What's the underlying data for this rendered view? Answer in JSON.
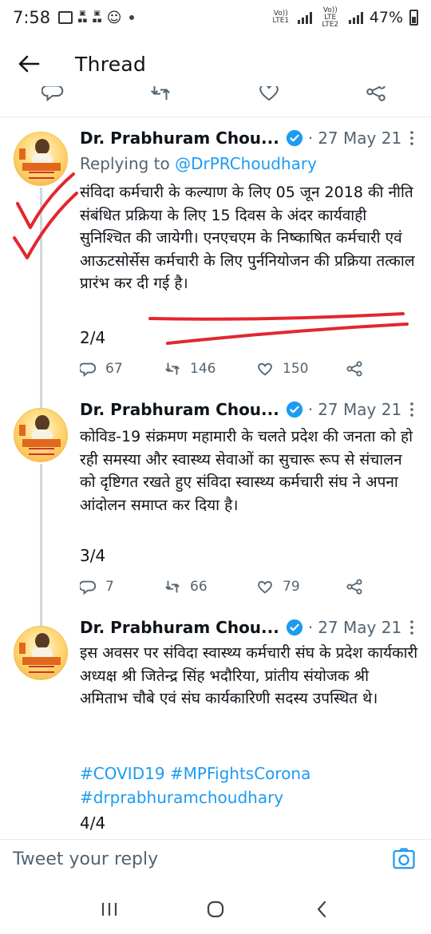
{
  "status_bar": {
    "time": "7:58",
    "net1": "Vo)) LTE1",
    "net2": "Vo)) LTE LTE2",
    "battery": "47%"
  },
  "header": {
    "title": "Thread"
  },
  "tweets": [
    {
      "name": "Dr. Prabhuram Chou...",
      "date": "27 May 21",
      "replying_label": "Replying to",
      "replying_handle": "@DrPRChoudhary",
      "text": "संविदा कर्मचारी के कल्याण के लिए 05 जून 2018 की नीति संबंधित प्रक्रिया के लिए 15 दिवस के अंदर कार्यवाही सुनिश्चित की जायेगी। एनएचएम के निष्काषित कर्मचारी एवं आऊटसोर्सेस कर्मचारी के लिए पुर्ननियोजन की प्रक्रिया तत्काल प्रारंभ कर दी गई है।",
      "count": "2/4",
      "replies": "67",
      "retweets": "146",
      "likes": "150"
    },
    {
      "name": "Dr. Prabhuram Chou...",
      "date": "27 May 21",
      "text": "कोविड-19 संक्रमण महामारी के चलते प्रदेश की जनता को हो रही समस्या और स्वास्थ्य सेवाओं का सुचारू रूप से संचालन को दृष्टिगत रखते हुए संविदा स्वास्थ्य कर्मचारी संघ ने अपना आंदोलन समाप्त कर दिया है।",
      "count": "3/4",
      "replies": "7",
      "retweets": "66",
      "likes": "79"
    },
    {
      "name": "Dr. Prabhuram Chou...",
      "date": "27 May 21",
      "text": "इस अवसर पर संविदा स्वास्थ्य कर्मचारी संघ के प्रदेश कार्यकारी अध्यक्ष श्री जितेन्द्र सिंह भदौरिया, प्रांतीय संयोजक श्री अमिताभ चौबे एवं संघ कार्यकारिणी सदस्य उपस्थित थे।",
      "hashtags": "#COVID19 #MPFightsCorona #drprabhuramchoudhary",
      "count": "4/4"
    }
  ],
  "reply_bar": {
    "placeholder": "Tweet your reply"
  },
  "colors": {
    "accent": "#1d9bf0",
    "text": "#0f1419",
    "secondary": "#536471",
    "ink": "#e3262e"
  },
  "icons": {
    "back": "arrow-left-icon",
    "verified": "verified-badge-icon",
    "more": "more-vertical-icon",
    "reply": "reply-icon",
    "retweet": "retweet-icon",
    "like": "heart-icon",
    "share": "share-icon",
    "camera": "camera-icon"
  }
}
